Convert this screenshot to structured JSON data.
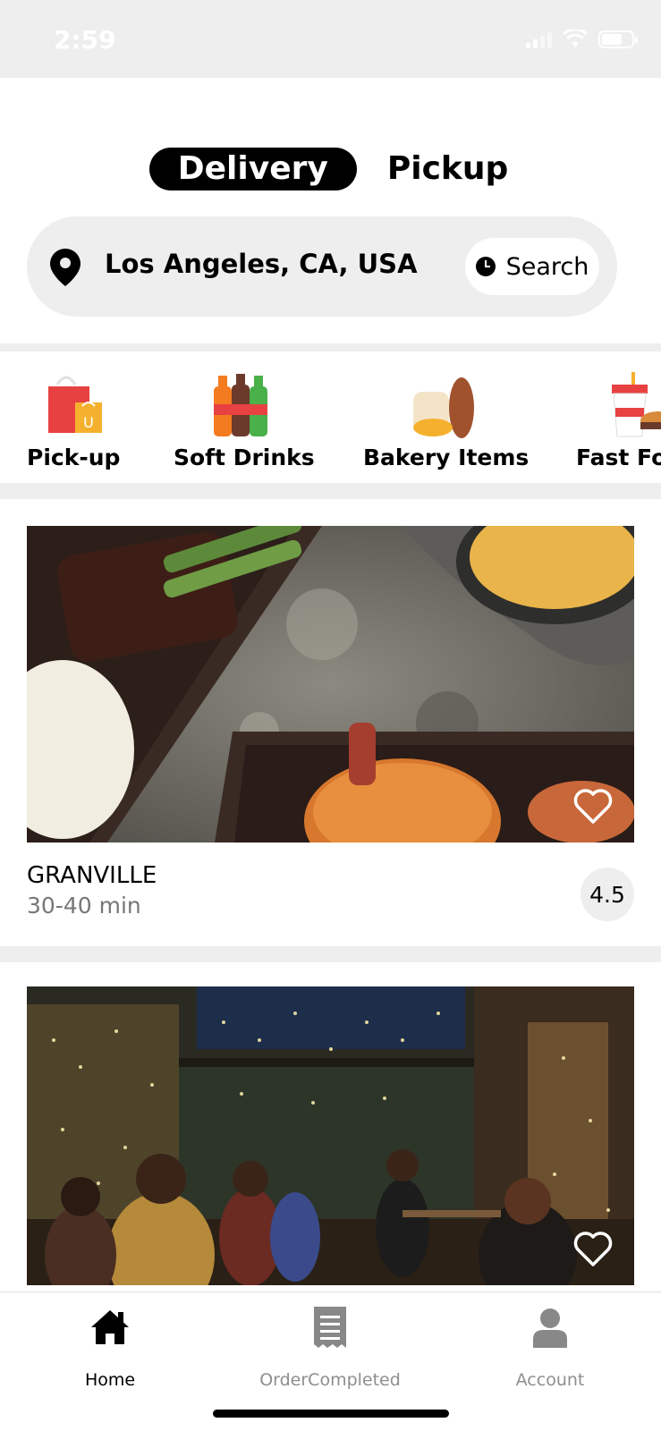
{
  "status_bar": {
    "time": "2:59"
  },
  "mode_toggle": {
    "delivery_label": "Delivery",
    "pickup_label": "Pickup",
    "active": "Delivery"
  },
  "location_bar": {
    "location": "Los Angeles, CA, USA",
    "search_label": "Search"
  },
  "categories": [
    {
      "label": "Pick-up",
      "icon": "shopping-bag-icon"
    },
    {
      "label": "Soft Drinks",
      "icon": "soda-bottles-icon"
    },
    {
      "label": "Bakery Items",
      "icon": "bread-icon"
    },
    {
      "label": "Fast Fo",
      "icon": "fast-food-icon"
    }
  ],
  "restaurants": [
    {
      "name": "GRANVILLE",
      "time": "30-40 min",
      "rating": "4.5",
      "image": "grilled-steak-and-burger-photo"
    },
    {
      "name": "",
      "time": "",
      "rating": "",
      "image": "outdoor-patio-dining-photo"
    }
  ],
  "tab_bar": {
    "tabs": [
      {
        "label": "Home",
        "icon": "home-icon",
        "active": true
      },
      {
        "label": "OrderCompleted",
        "icon": "receipt-icon",
        "active": false
      },
      {
        "label": "Account",
        "icon": "person-icon",
        "active": false
      }
    ]
  },
  "colors": {
    "accent": "#000000",
    "background_gray": "#eeeeee",
    "muted_text": "#777777"
  }
}
